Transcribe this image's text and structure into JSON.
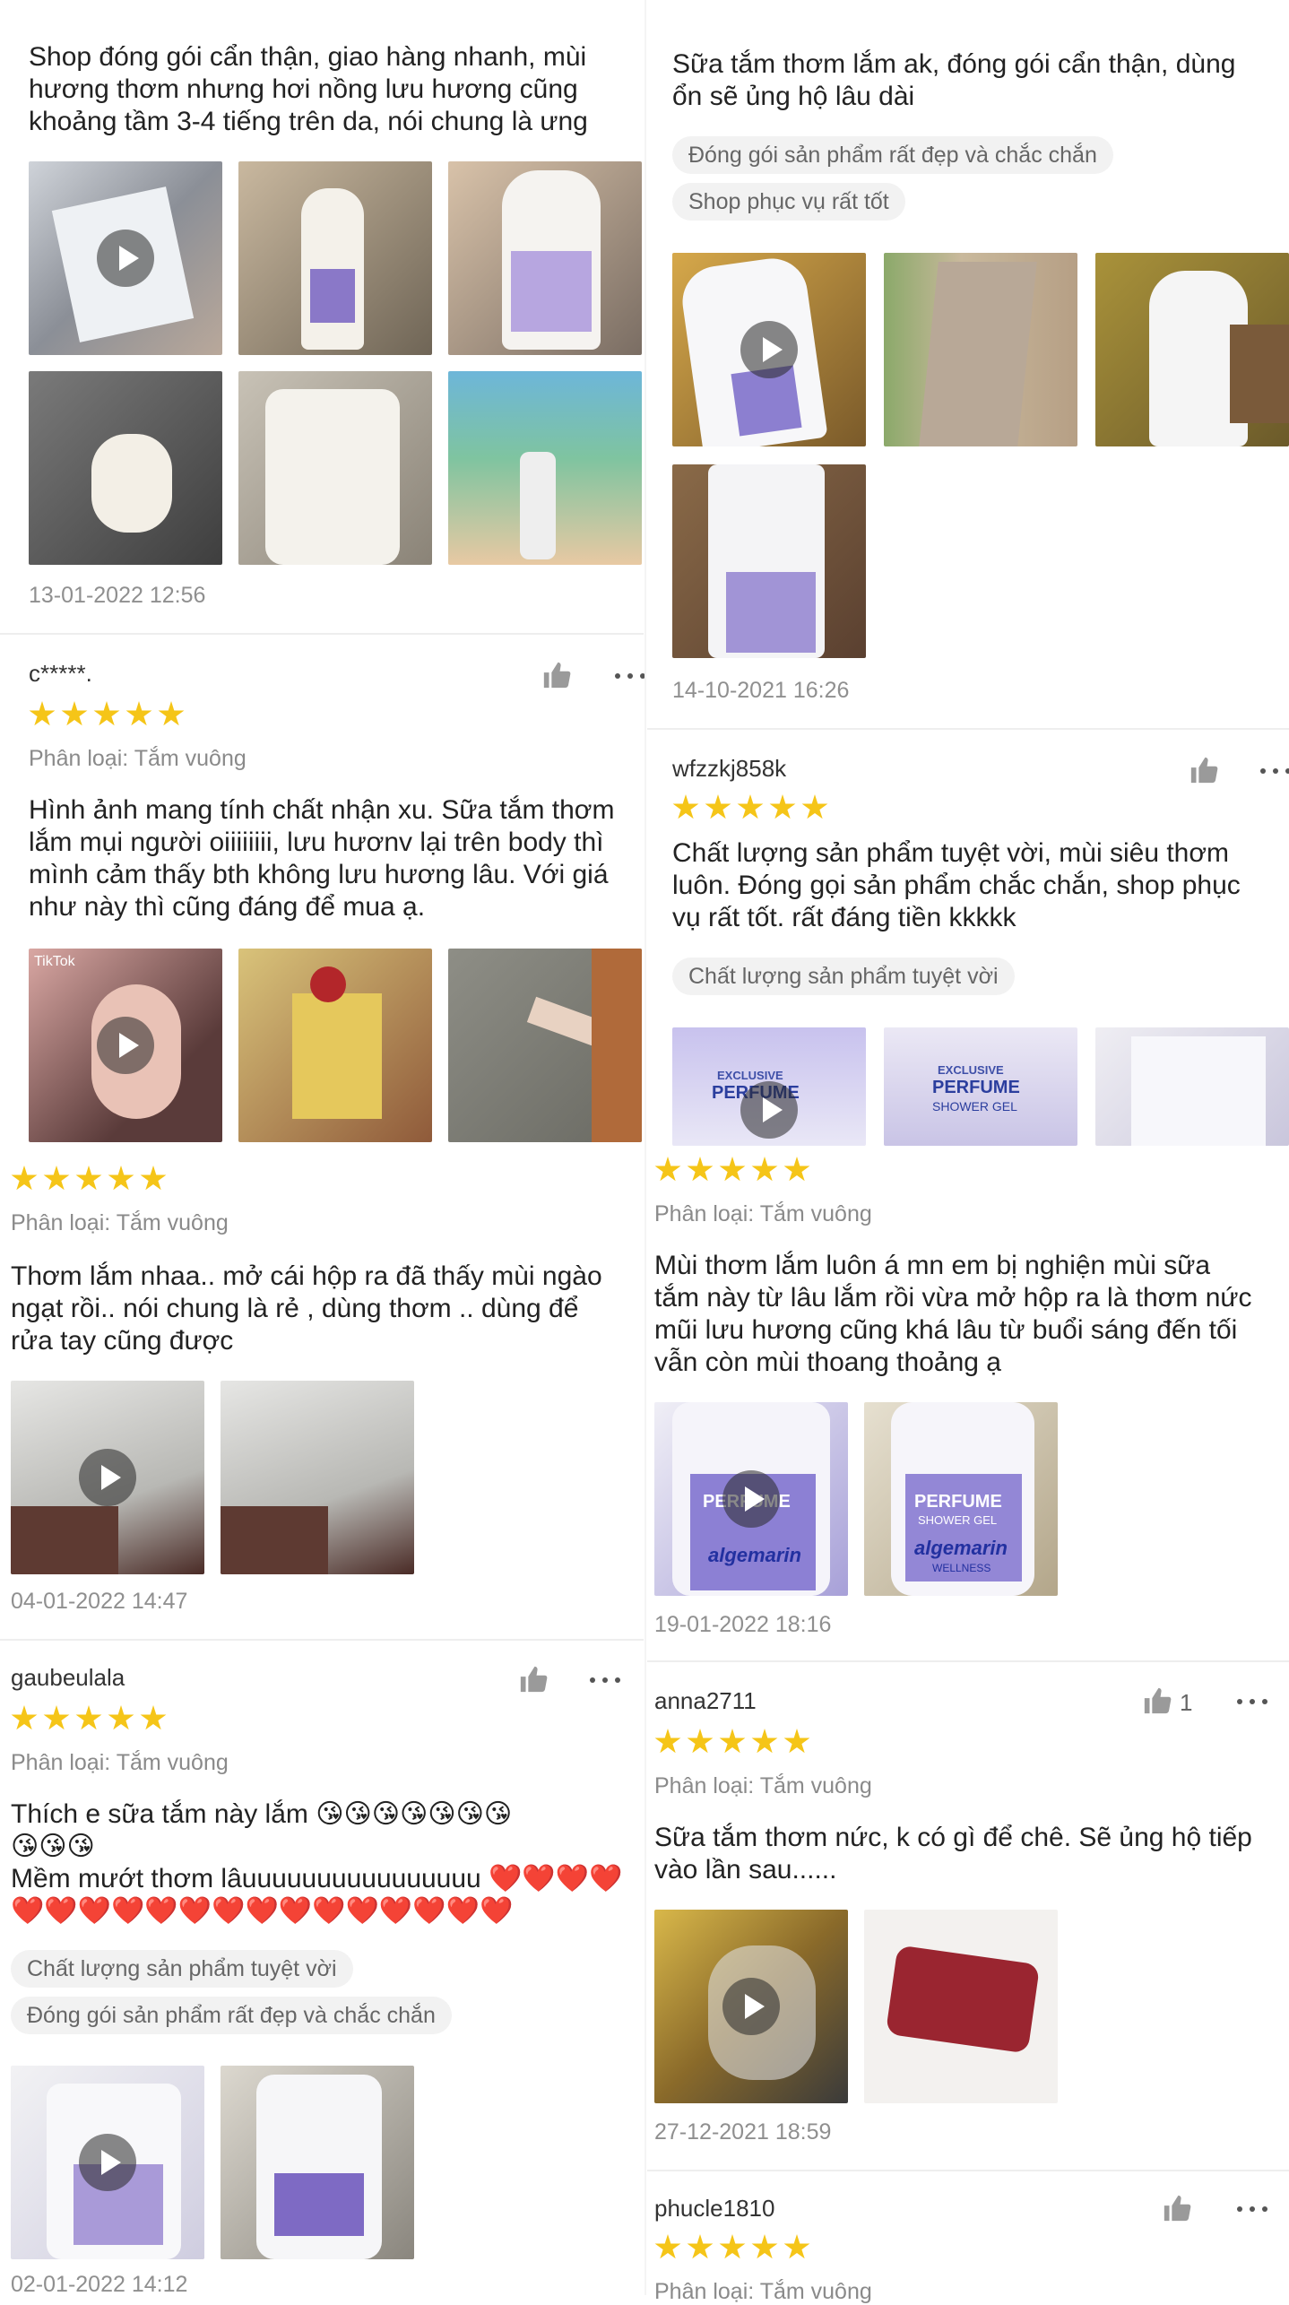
{
  "left": [
    {
      "text": "Shop đóng gói cẩn thận, giao hàng nhanh, mùi\nhương thơm nhưng hơi nồng lưu hương cũng\nkhoảng tầm 3-4 tiếng trên da, nói chung là ưng",
      "date": "13-01-2022 12:56"
    },
    {
      "user": "c*****.",
      "variant": "Phân loại: Tắm vuông",
      "text": "Hình ảnh mang tính chất nhận xu. Sữa tắm thơm\nlắm mụi người oiiiiiiii, lưu hươnv lại trên body thì\nmình cảm thấy bth không lưu hương lâu. Với giá\nnhư này thì cũng đáng để mua ạ.",
      "thumb_label": "TikTok"
    },
    {
      "variant": "Phân loại: Tắm vuông",
      "text": "Thơm lắm nhaa.. mở cái hộp ra đã thấy mùi ngào\nngạt rồi.. nói chung là rẻ , dùng thơm .. dùng để\nrửa tay cũng được",
      "date": "04-01-2022 14:47"
    },
    {
      "user": "gaubeulala",
      "variant": "Phân loại: Tắm vuông",
      "text": "Thích e sữa tắm này lắm 😘😘😘😘😘😘😘\n😘😘😘\nMềm mướt thơm lâuuuuuuuuuuuuuuuu ❤️❤️❤️❤️\n❤️❤️❤️❤️❤️❤️❤️❤️❤️❤️❤️❤️❤️❤️❤️",
      "tags": [
        "Chất lượng sản phẩm tuyệt vời",
        "Đóng gói sản phẩm rất đẹp và chắc chắn"
      ],
      "date": "02-01-2022 14:12"
    }
  ],
  "right": [
    {
      "text": "Sữa tắm thơm lắm ak, đóng gói cẩn thận, dùng\nổn sẽ ủng hộ lâu dài",
      "tags": [
        "Đóng gói sản phẩm rất đẹp và chắc chắn",
        "Shop phục vụ rất tốt"
      ],
      "date": "14-10-2021 16:26",
      "bottle_labels": [
        "EXCLUSIVE",
        "PERFUME",
        "SHOWER GEL",
        "algemarin"
      ]
    },
    {
      "user": "wfzzkj858k",
      "text": "Chất lượng sản phẩm tuyệt vời, mùi siêu thơm\nluôn. Đóng gọi sản phẩm chắc chắn, shop phục\nvụ rất tốt. rất đáng tiền kkkkk",
      "tags": [
        "Chất lượng sản phẩm tuyệt vời"
      ],
      "bottle_labels": [
        "EXCLUSIVE",
        "PERFUME",
        "SHOWER GEL"
      ]
    },
    {
      "variant": "Phân loại: Tắm vuông",
      "text": "Mùi thơm lắm luôn á mn em bị nghiện mùi sữa\ntắm này từ lâu lắm rồi vừa mở hộp ra là thơm nức\nmũi lưu hương cũng khá lâu từ buổi sáng đến tối\nvẫn còn mùi thoang thoảng ạ",
      "date": "19-01-2022 18:16",
      "bottle_labels": [
        "PERFUME",
        "SHOWER GEL",
        "algemarin",
        "WELLNESS"
      ]
    },
    {
      "user": "anna2711",
      "likes": "1",
      "variant": "Phân loại: Tắm vuông",
      "text": "Sữa tắm thơm nức, k có gì để chê. Sẽ ủng hộ tiếp\nvào lần sau......",
      "date": "27-12-2021 18:59"
    },
    {
      "user": "phucle1810",
      "variant": "Phân loại: Tắm vuông"
    }
  ],
  "colors": {
    "star": "#f5c518",
    "divider": "#eeeeee",
    "tag_bg": "#f2f2f2"
  },
  "icons": {
    "like": "thumb-up-icon",
    "more": "more-dots-icon",
    "play": "play-icon",
    "star": "star-icon"
  }
}
